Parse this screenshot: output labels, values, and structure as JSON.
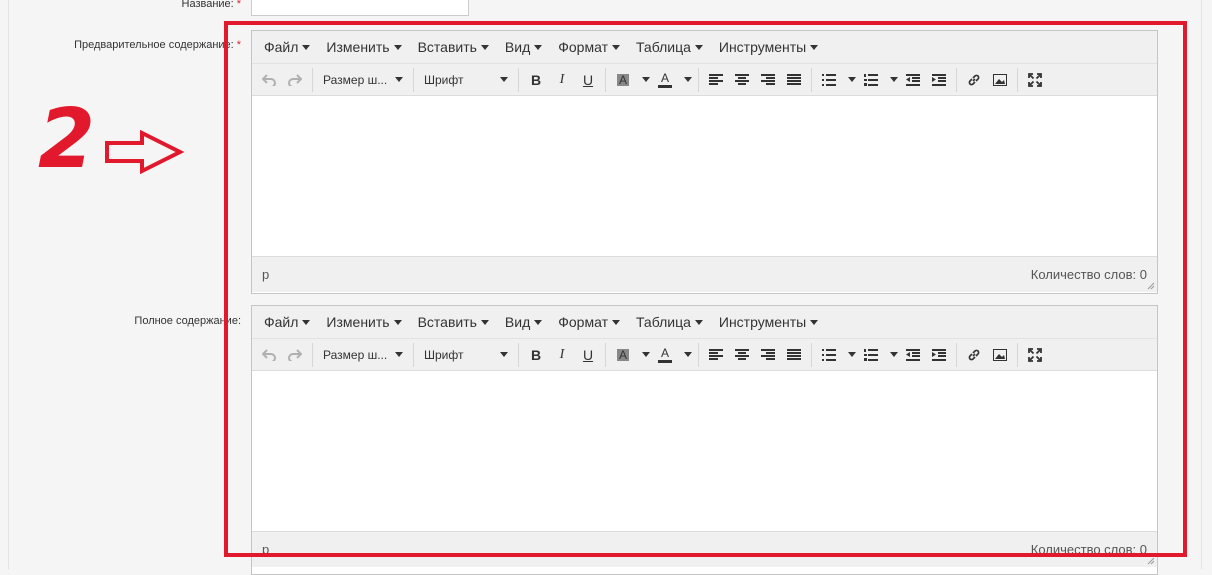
{
  "form": {
    "name_label": "Название:",
    "required_mark": "*",
    "preview_label": "Предварительное содержание:",
    "full_label": "Полное содержание:"
  },
  "editor": {
    "menu": [
      "Файл",
      "Изменить",
      "Вставить",
      "Вид",
      "Формат",
      "Таблица",
      "Инструменты"
    ],
    "font_size_select": "Размер ш...",
    "font_family_select": "Шрифт",
    "bold": "B",
    "italic": "I",
    "underline": "U",
    "text_color": "A",
    "status_path": "p",
    "word_count": "Количество слов: 0"
  },
  "annotation": {
    "number": "2",
    "color": "#e2192c"
  }
}
